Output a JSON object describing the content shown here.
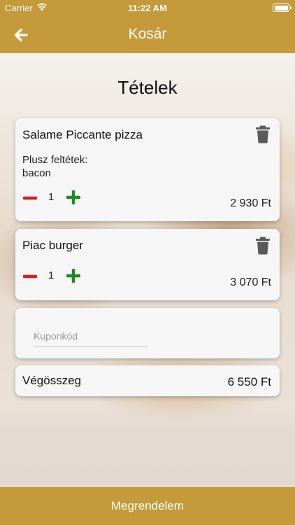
{
  "status_bar": {
    "carrier": "Carrier",
    "time": "11:22 AM"
  },
  "nav": {
    "title": "Kosár"
  },
  "cart": {
    "section_title": "Tételek",
    "items": [
      {
        "name": "Salame Piccante pizza",
        "extras_label": "Plusz feltétek:",
        "extras": "bacon",
        "quantity": "1",
        "price": "2 930 Ft"
      },
      {
        "name": "Piac burger",
        "quantity": "1",
        "price": "3 070 Ft"
      }
    ],
    "coupon": {
      "placeholder": "Kuponkód",
      "value": ""
    },
    "total": {
      "label": "Végösszeg",
      "value": "6 550 Ft"
    }
  },
  "order_button": {
    "label": "Megrendelem"
  },
  "colors": {
    "brand": "#c49a3a",
    "minus": "#d81d1d",
    "plus": "#1f8a22",
    "trash": "#5a5a5a"
  },
  "icons": [
    "back-arrow-icon",
    "trash-icon",
    "minus-icon",
    "plus-icon",
    "wifi-icon",
    "battery-icon"
  ]
}
